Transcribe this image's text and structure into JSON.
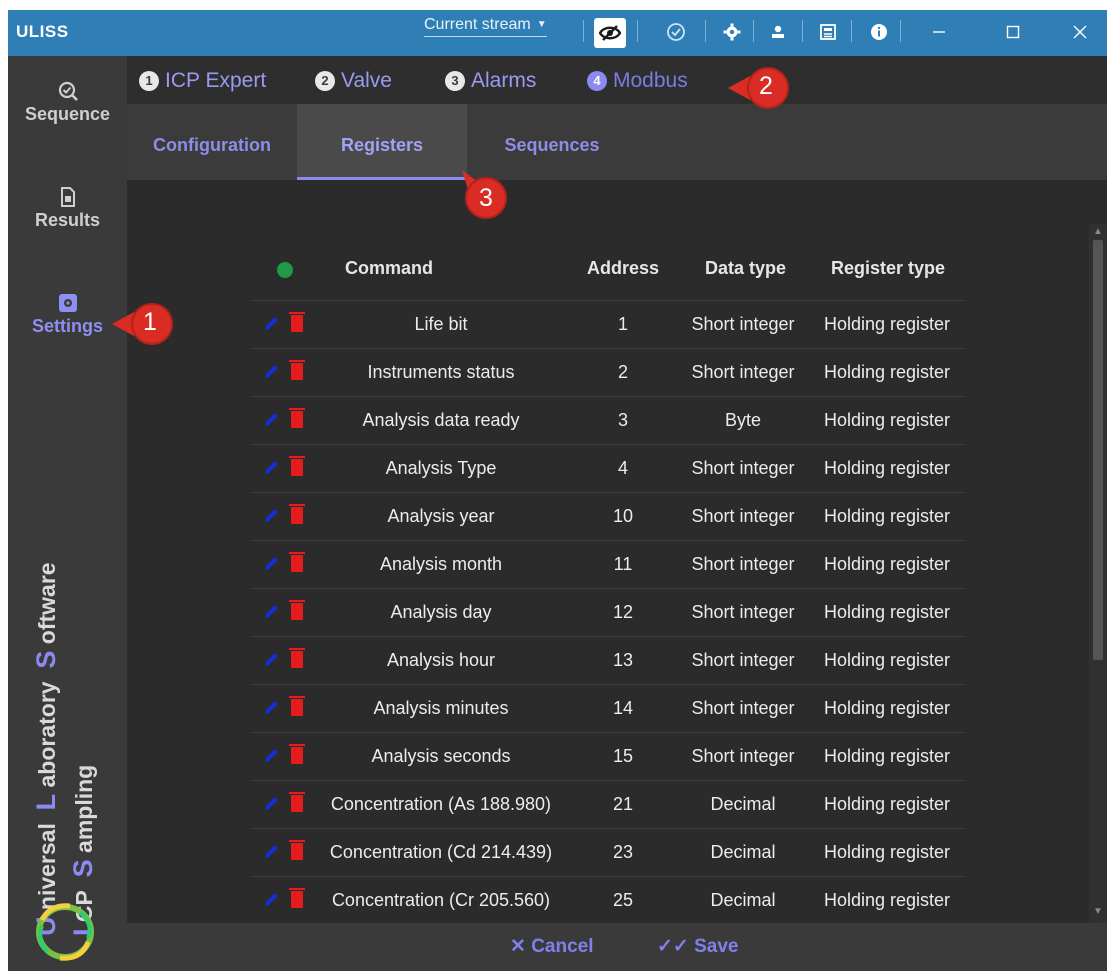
{
  "app": {
    "title": "ULISS"
  },
  "titlebar": {
    "stream_select": "Current stream",
    "icons": [
      "eye-off-icon",
      "check-circle-icon",
      "gear-icon",
      "user-icon",
      "report-icon",
      "info-icon",
      "minimize-icon",
      "maximize-icon",
      "close-icon"
    ]
  },
  "sidebar": {
    "items": [
      {
        "label": "Sequence",
        "icon": "sequence-icon"
      },
      {
        "label": "Results",
        "icon": "document-icon"
      },
      {
        "label": "Settings",
        "icon": "settings-icon"
      }
    ],
    "brand": {
      "line1": {
        "c1": "U",
        "w1": "niversal",
        "c2": "L",
        "w2": "aboratory",
        "c3": "S",
        "w3": "oftware"
      },
      "line2": {
        "c1": "I",
        "w1": "CP",
        "c2": "S",
        "w2": "ampling"
      }
    }
  },
  "main_tabs": [
    {
      "num": "1",
      "label": "ICP Expert"
    },
    {
      "num": "2",
      "label": "Valve"
    },
    {
      "num": "3",
      "label": "Alarms"
    },
    {
      "num": "4",
      "label": "Modbus"
    }
  ],
  "sub_tabs": [
    {
      "label": "Configuration"
    },
    {
      "label": "Registers"
    },
    {
      "label": "Sequences"
    }
  ],
  "table": {
    "headers": {
      "command": "Command",
      "address": "Address",
      "data_type": "Data type",
      "register_type": "Register type"
    },
    "rows": [
      {
        "command": "Life bit",
        "address": "1",
        "data_type": "Short integer",
        "register_type": "Holding register"
      },
      {
        "command": "Instruments status",
        "address": "2",
        "data_type": "Short integer",
        "register_type": "Holding register"
      },
      {
        "command": "Analysis data ready",
        "address": "3",
        "data_type": "Byte",
        "register_type": "Holding register"
      },
      {
        "command": "Analysis Type",
        "address": "4",
        "data_type": "Short integer",
        "register_type": "Holding register"
      },
      {
        "command": "Analysis year",
        "address": "10",
        "data_type": "Short integer",
        "register_type": "Holding register"
      },
      {
        "command": "Analysis month",
        "address": "11",
        "data_type": "Short integer",
        "register_type": "Holding register"
      },
      {
        "command": "Analysis day",
        "address": "12",
        "data_type": "Short integer",
        "register_type": "Holding register"
      },
      {
        "command": "Analysis hour",
        "address": "13",
        "data_type": "Short integer",
        "register_type": "Holding register"
      },
      {
        "command": "Analysis minutes",
        "address": "14",
        "data_type": "Short integer",
        "register_type": "Holding register"
      },
      {
        "command": "Analysis seconds",
        "address": "15",
        "data_type": "Short integer",
        "register_type": "Holding register"
      },
      {
        "command": "Concentration (As 188.980)",
        "address": "21",
        "data_type": "Decimal",
        "register_type": "Holding register"
      },
      {
        "command": "Concentration (Cd 214.439)",
        "address": "23",
        "data_type": "Decimal",
        "register_type": "Holding register"
      },
      {
        "command": "Concentration (Cr 205.560)",
        "address": "25",
        "data_type": "Decimal",
        "register_type": "Holding register"
      }
    ]
  },
  "footer": {
    "cancel": "Cancel",
    "save": "Save"
  },
  "callouts": [
    "1",
    "2",
    "3"
  ],
  "colors": {
    "accent": "#8a8af0",
    "titlebar": "#2f7fb6",
    "delete": "#e51c1c",
    "edit": "#1a2bd6",
    "add": "#1f9a48",
    "callout": "#d82c24"
  }
}
